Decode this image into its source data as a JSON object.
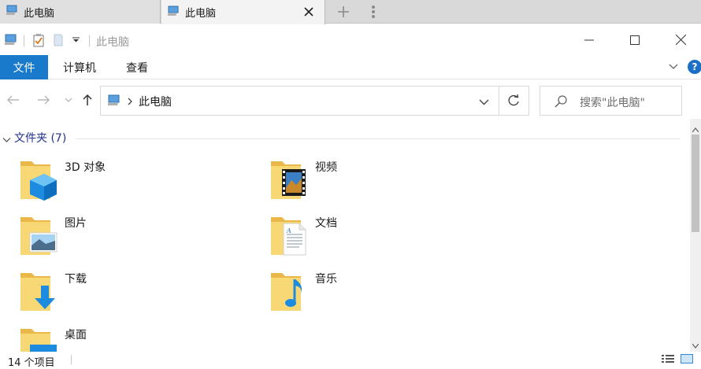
{
  "tabs": [
    {
      "title": "此电脑",
      "active": false
    },
    {
      "title": "此电脑",
      "active": true
    }
  ],
  "window": {
    "title": "此电脑"
  },
  "ribbon": {
    "file": "文件",
    "computer": "计算机",
    "view": "查看",
    "help": "?"
  },
  "address": {
    "crumb": "此电脑",
    "search_placeholder": "搜索\"此电脑\""
  },
  "group": {
    "header": "文件夹 (7)"
  },
  "folders": [
    {
      "label": "3D 对象",
      "icon": "3d-objects-folder-icon"
    },
    {
      "label": "视频",
      "icon": "videos-folder-icon"
    },
    {
      "label": "图片",
      "icon": "pictures-folder-icon"
    },
    {
      "label": "文档",
      "icon": "documents-folder-icon"
    },
    {
      "label": "下载",
      "icon": "downloads-folder-icon"
    },
    {
      "label": "音乐",
      "icon": "music-folder-icon"
    },
    {
      "label": "桌面",
      "icon": "desktop-folder-icon"
    }
  ],
  "status": {
    "count": "14 个项目"
  },
  "colors": {
    "accent": "#1979ca",
    "folder": "#f4c962",
    "group_header": "#1e3287"
  }
}
